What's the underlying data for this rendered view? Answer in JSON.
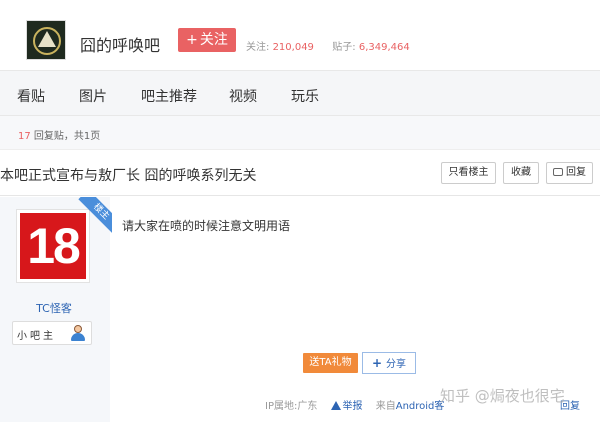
{
  "header": {
    "bar_name": "囧的呼唤吧",
    "follow_label": "关注",
    "follow_prefix": "+",
    "stats": {
      "followers_label": "关注:",
      "followers_value": "210,049",
      "posts_label": "贴子:",
      "posts_value": "6,349,464"
    }
  },
  "nav": {
    "items": [
      "看贴",
      "图片",
      "吧主推荐",
      "视频",
      "玩乐"
    ]
  },
  "thread_info": {
    "reply_count": "17",
    "reply_label": "回复贴，共1页"
  },
  "thread": {
    "title": "本吧正式宣布与敖厂长 囧的呼唤系列无关",
    "buttons": {
      "only_op": "只看楼主",
      "favorite": "收藏",
      "reply": "回复"
    }
  },
  "post": {
    "avatar_text": "18",
    "ribbon_label": "楼主",
    "username": "TC怪客",
    "badge_label": "小吧主",
    "content": "请大家在喷的时候注意文明用语",
    "gift_label": "送TA礼物",
    "share_label": "分享",
    "share_prefix": "+",
    "ip_label": "IP属地:广东",
    "report_label": "举报",
    "source_prefix": "来自",
    "source_value": "Android客",
    "reply_link": "回复"
  },
  "watermark": "知乎 @焗夜也很宅",
  "colors": {
    "accent_red": "#e96263",
    "link_blue": "#2d64b3",
    "gift_orange": "#f18a3a"
  },
  "icons": [
    "logo",
    "reply-icon",
    "person-icon",
    "warning-icon",
    "plus-icon"
  ]
}
